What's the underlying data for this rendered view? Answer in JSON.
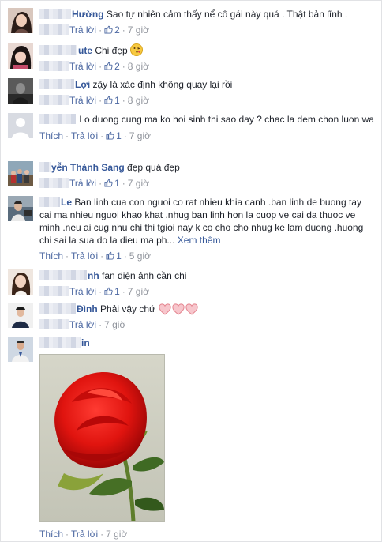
{
  "ui": {
    "like_label": "Thích",
    "reply_label": "Trả lời",
    "separator": "·"
  },
  "comments": [
    {
      "name": "Hường",
      "text": "Sao tự nhiên cảm thấy nể cô gái này quá . Thật bản lĩnh .",
      "likes": "2",
      "time": "7 giờ"
    },
    {
      "name": "ute",
      "text": "Chị đẹp",
      "emoji": "kissing-face",
      "likes": "2",
      "time": "8 giờ"
    },
    {
      "name": "Lợi",
      "text": "zậy là xác định không quay lại rồi",
      "likes": "1",
      "time": "8 giờ"
    },
    {
      "name": "",
      "text": "Lo duong cung ma ko hoi sinh thi sao day ? chac la dem chon luon wa",
      "likes": "1",
      "time": "7 giờ"
    },
    {
      "name": "yễn Thành Sang",
      "text": "đẹp quá đẹp",
      "likes": "1",
      "time": "7 giờ"
    },
    {
      "name": "Le",
      "text": "Ban linh cua con nguoi co rat nhieu khia canh .ban linh de buong tay cai ma nhieu nguoi khao khat .nhug ban linh hon la cuop ve cai da thuoc ve minh .neu ai cug nhu chi thi tgioi nay k co cho cho nhug ke lam duong .huong chi sai la sua do la dieu ma ph...",
      "see_more": "Xem thêm",
      "likes": "1",
      "time": "5 giờ"
    },
    {
      "name": "nh",
      "text": "fan điện ảnh cần chị",
      "likes": "1",
      "time": "7 giờ"
    },
    {
      "name": "Đình",
      "text": "Phải vậy chứ",
      "hearts": 3,
      "time": "7 giờ"
    },
    {
      "name": "in",
      "text": "",
      "photo": "red-rose",
      "time": "7 giờ"
    }
  ],
  "colors": {
    "link": "#365899",
    "meta": "#90949c",
    "action": "#4b67a1",
    "heart": "#f3b0b8"
  }
}
